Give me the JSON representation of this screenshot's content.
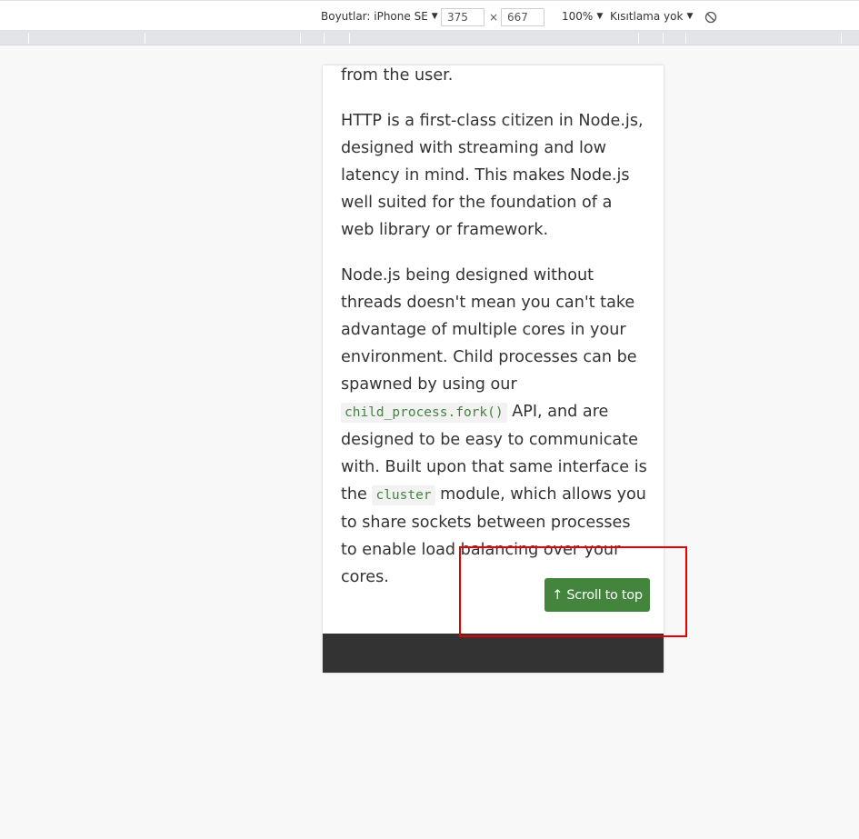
{
  "toolbar": {
    "dimensions_label": "Boyutlar: iPhone SE",
    "width_value": "375",
    "height_value": "667",
    "times_sign": "×",
    "zoom_label": "100%",
    "throttle_label": "Kısıtlama yok",
    "caret": "▼",
    "rotate_icon": "rotate-icon"
  },
  "content": {
    "p1_tail": "from the user.",
    "p2": "HTTP is a first-class citizen in Node.js, designed with streaming and low latency in mind. This makes Node.js well suited for the foundation of a web library or framework.",
    "p3_a": "Node.js being designed without threads doesn't mean you can't take advantage of multiple cores in your environment. Child processes can be spawned by using our ",
    "p3_code1": "child_process.fork()",
    "p3_b": " API, and are designed to be easy to communicate with. Built upon that same interface is the ",
    "p3_code2": "cluster",
    "p3_c": " module, which allows you to share sockets between processes to enable load balancing over your cores."
  },
  "scroll_button": {
    "label": "↑ Scroll to top"
  },
  "colors": {
    "accent": "#43853d",
    "footer": "#333333",
    "highlight": "#e60000",
    "text": "#333333"
  }
}
